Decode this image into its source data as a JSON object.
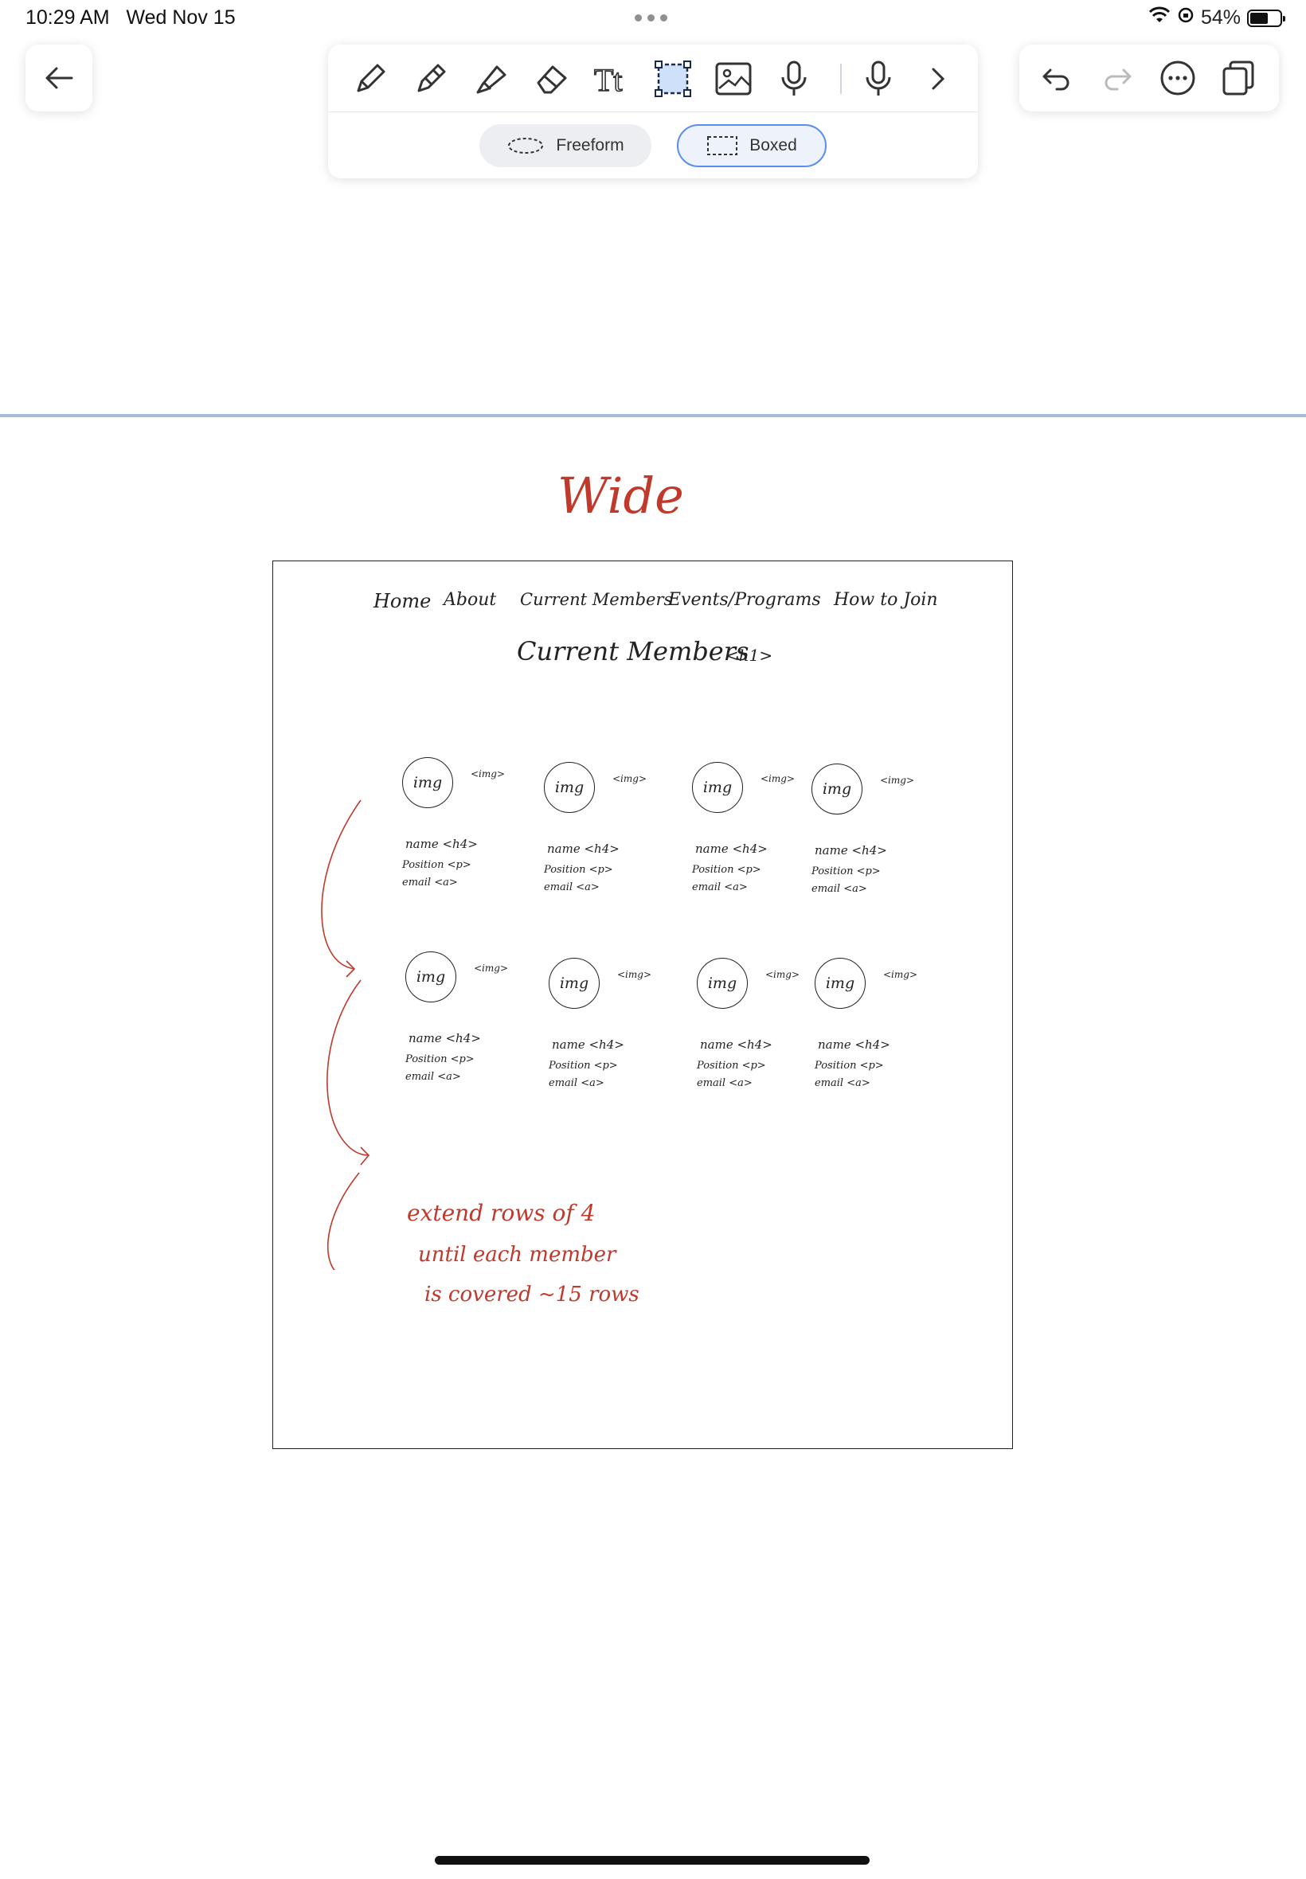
{
  "status_bar": {
    "time": "10:29 AM",
    "date": "Wed Nov 15",
    "battery": "54%",
    "battery_level": 0.54
  },
  "toolbar": {
    "tools": [
      "pen-icon",
      "fountain-pen-icon",
      "highlighter-icon",
      "eraser-icon",
      "text-icon",
      "lasso-select-icon",
      "image-icon",
      "microphone-icon",
      "microphone-icon",
      "chevron-right-icon"
    ],
    "freeform_label": "Freeform",
    "boxed_label": "Boxed",
    "selected_mode": "Boxed",
    "accent": "#5b8def"
  },
  "right_tools": [
    "undo-icon",
    "redo-icon",
    "more-icon",
    "pages-icon"
  ],
  "sketch": {
    "title": "Wide",
    "nav": [
      "Home",
      "About",
      "Current Members",
      "Events/Programs",
      "How to Join"
    ],
    "heading": "Current Members",
    "heading_tag": "<h1>",
    "members": [
      {
        "img": "img",
        "tag": "<img>",
        "name": "name <h4>",
        "position": "Position <p>",
        "email": "email <a>"
      },
      {
        "img": "img",
        "tag": "<img>",
        "name": "name <h4>",
        "position": "Position <p>",
        "email": "email <a>"
      },
      {
        "img": "img",
        "tag": "<img>",
        "name": "name <h4>",
        "position": "Position <p>",
        "email": "email <a>"
      },
      {
        "img": "img",
        "tag": "<img>",
        "name": "name <h4>",
        "position": "Position <p>",
        "email": "email <a>"
      },
      {
        "img": "img",
        "tag": "<img>",
        "name": "name <h4>",
        "position": "Position <p>",
        "email": "email <a>"
      },
      {
        "img": "img",
        "tag": "<img>",
        "name": "name <h4>",
        "position": "Position <p>",
        "email": "email <a>"
      },
      {
        "img": "img",
        "tag": "<img>",
        "name": "name <h4>",
        "position": "Position <p>",
        "email": "email <a>"
      },
      {
        "img": "img",
        "tag": "<img>",
        "name": "name <h4>",
        "position": "Position <p>",
        "email": "email <a>"
      }
    ],
    "note_lines": [
      "extend rows of 4",
      "until each member",
      "is covered ~15 rows"
    ],
    "ink_color": "#222222",
    "annotation_color": "#c0392b"
  }
}
